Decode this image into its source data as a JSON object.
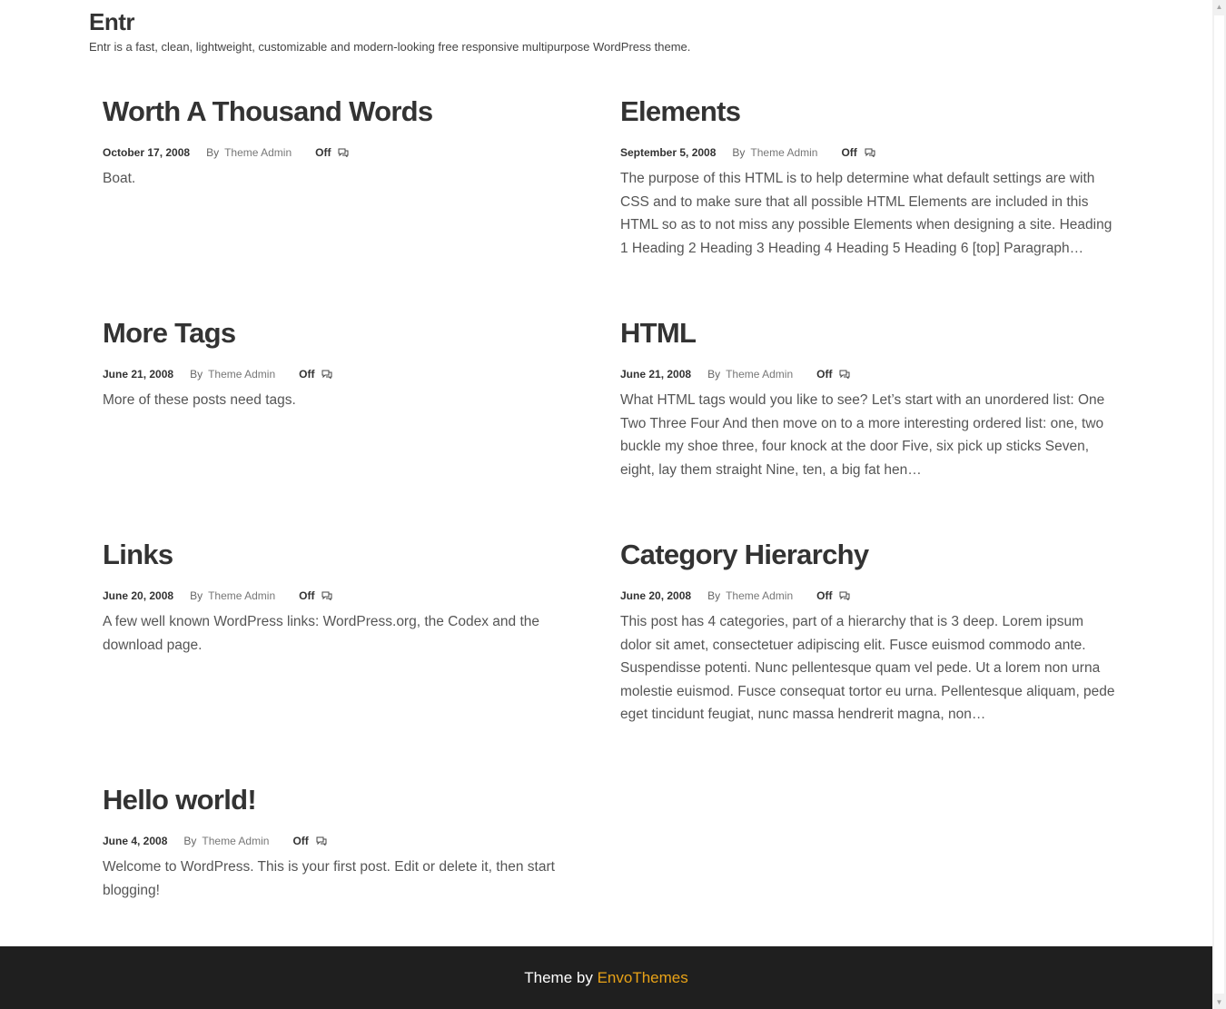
{
  "site": {
    "title": "Entr",
    "description": "Entr is a fast, clean, lightweight, customizable and modern-looking free responsive multipurpose WordPress theme."
  },
  "posts": [
    {
      "title": "Worth A Thousand Words",
      "date": "October 17, 2008",
      "by": "By",
      "author": "Theme Admin",
      "comments": "Off",
      "excerpt": "Boat."
    },
    {
      "title": "Elements",
      "date": "September 5, 2008",
      "by": "By",
      "author": "Theme Admin",
      "comments": "Off",
      "excerpt": "The purpose of this HTML is to help determine what default settings are with CSS and to make sure that all possible HTML Elements are included in this HTML so as to not miss any possible Elements when designing a site. Heading 1 Heading 2 Heading 3 Heading 4 Heading 5 Heading 6 [top] Paragraph…"
    },
    {
      "title": "More Tags",
      "date": "June 21, 2008",
      "by": "By",
      "author": "Theme Admin",
      "comments": "Off",
      "excerpt": "More of these posts need tags."
    },
    {
      "title": "HTML",
      "date": "June 21, 2008",
      "by": "By",
      "author": "Theme Admin",
      "comments": "Off",
      "excerpt": "What HTML tags would you like to see? Let’s start with an unordered list: One Two Three Four And then move on to a more interesting ordered list: one, two buckle my shoe three, four knock at the door Five, six pick up sticks Seven, eight, lay them straight Nine, ten, a big fat hen…"
    },
    {
      "title": "Links",
      "date": "June 20, 2008",
      "by": "By",
      "author": "Theme Admin",
      "comments": "Off",
      "excerpt": "A few well known WordPress links: WordPress.org, the Codex and the download page."
    },
    {
      "title": "Category Hierarchy",
      "date": "June 20, 2008",
      "by": "By",
      "author": "Theme Admin",
      "comments": "Off",
      "excerpt": "This post has 4 categories, part of a hierarchy that is 3 deep. Lorem ipsum dolor sit amet, consectetuer adipiscing elit. Fusce euismod commodo ante. Suspendisse potenti. Nunc pellentesque quam vel pede. Ut a lorem non urna molestie euismod. Fusce consequat tortor eu urna. Pellentesque aliquam, pede eget tincidunt feugiat, nunc massa hendrerit magna, non…"
    },
    {
      "title": "Hello world!",
      "date": "June 4, 2008",
      "by": "By",
      "author": "Theme Admin",
      "comments": "Off",
      "excerpt": "Welcome to WordPress. This is your first post. Edit or delete it, then start blogging!"
    }
  ],
  "footer": {
    "prefix": "Theme by",
    "link_label": "EnvoThemes",
    "link_color": "#e8a217",
    "background": "#1f1f1f"
  },
  "icons": {
    "comment": "comment-icon",
    "scroll_up": "scroll-up-arrow-icon",
    "scroll_down": "scroll-down-arrow-icon"
  }
}
